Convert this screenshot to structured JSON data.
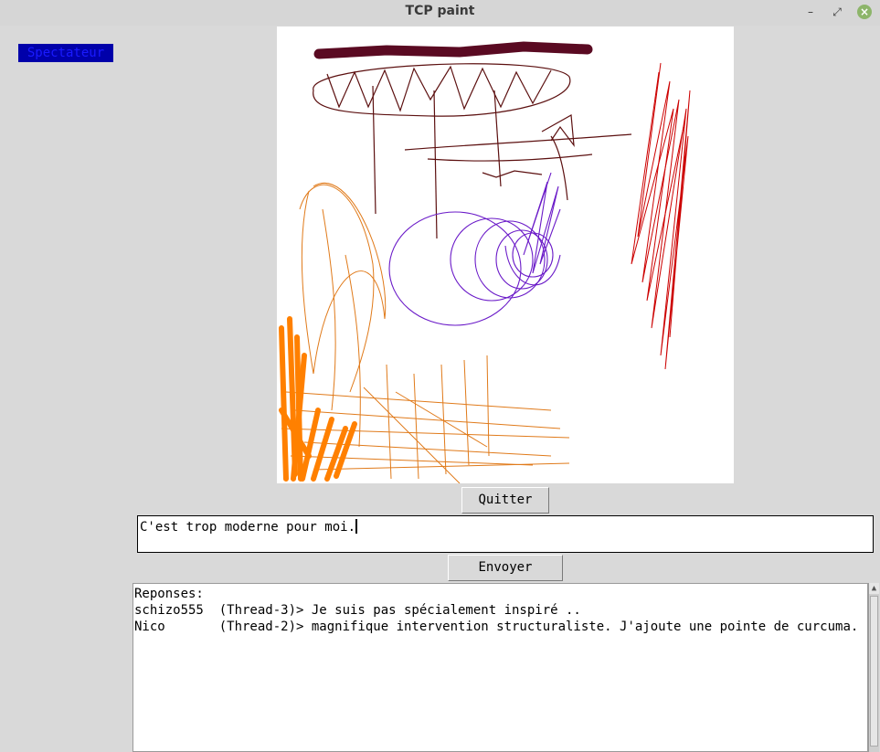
{
  "window": {
    "title": "TCP paint",
    "minimize_glyph": "–",
    "maximize_glyph": "⤢",
    "close_glyph": "×"
  },
  "mode_badge": {
    "label": "Spectateur",
    "background": "#0000aa",
    "text_color": "#1a1aff"
  },
  "canvas": {
    "background": "#ffffff",
    "stroke_colors": [
      "#5a0a22",
      "#5c1010",
      "#cc0000",
      "#6a1ac8",
      "#ff8000",
      "#e07a1a"
    ]
  },
  "buttons": {
    "quit_label": "Quitter",
    "send_label": "Envoyer"
  },
  "message_input": {
    "value": "C'est trop moderne pour moi."
  },
  "responses": {
    "lines": [
      "Reponses:",
      "schizo555  (Thread-3)> Je suis pas spécialement inspiré ..",
      "Nico       (Thread-2)> magnifique intervention structuraliste. J'ajoute une pointe de curcuma."
    ]
  },
  "icons": {
    "scroll_up": "▲"
  }
}
